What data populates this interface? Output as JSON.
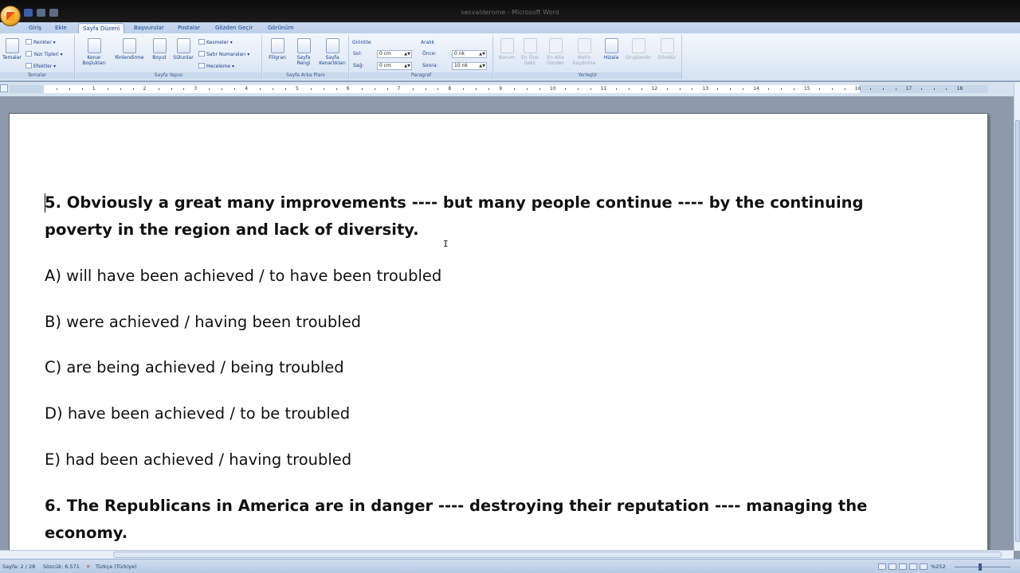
{
  "window": {
    "title": "sesvalderome - Microsoft Word"
  },
  "tabs": [
    {
      "label": "Giriş",
      "active": false
    },
    {
      "label": "Ekle",
      "active": false
    },
    {
      "label": "Sayfa Düzeni",
      "active": true
    },
    {
      "label": "Başvurular",
      "active": false
    },
    {
      "label": "Postalar",
      "active": false
    },
    {
      "label": "Gözden Geçir",
      "active": false
    },
    {
      "label": "Görünüm",
      "active": false
    }
  ],
  "ribbon": {
    "temalar": {
      "themes_button": "Temalar",
      "colors": "Renkler",
      "fonts": "Yazı Tipleri",
      "effects": "Efektler",
      "group_label": "Temalar"
    },
    "sayfa_yapisi": {
      "margins": "Kenar Boşlukları",
      "orientation": "Yönlendirme",
      "size": "Boyut",
      "columns": "Sütunlar",
      "breaks": "Kesmeler",
      "line_numbers": "Satır Numaraları",
      "hyphenation": "Heceleme",
      "group_label": "Sayfa Yapısı"
    },
    "sayfa_arka_plani": {
      "watermark": "Filigran",
      "page_color": "Sayfa Rengi",
      "page_borders": "Sayfa Kenarlıkları",
      "group_label": "Sayfa Arka Planı"
    },
    "paragraf": {
      "indent_label": "Girintile",
      "left_label": "Sol:",
      "left_value": "0 cm",
      "right_label": "Sağ:",
      "right_value": "0 cm",
      "spacing_label": "Aralık",
      "before_label": "Önce:",
      "before_value": "0 nk",
      "after_label": "Sonra:",
      "after_value": "10 nk",
      "group_label": "Paragraf"
    },
    "yerlestir": {
      "position": "Konum",
      "bring_front": "En Öne Getir",
      "send_back": "En Alta Gönder",
      "text_wrap": "Metin Kaydırma",
      "align": "Hizala",
      "group": "Gruplandır",
      "rotate": "Döndür",
      "group_label": "Yerleştir"
    }
  },
  "ruler": {
    "numbers": [
      "1",
      "2",
      "3",
      "4",
      "5",
      "6",
      "7",
      "8",
      "9",
      "10",
      "11",
      "12",
      "13",
      "14",
      "15",
      "16",
      "17",
      "18"
    ]
  },
  "document": {
    "paragraphs": [
      {
        "text": "5. Obviously a great many improvements ---- but many people continue ---- by the continuing",
        "bold": true
      },
      {
        "text": "poverty in the region and lack of diversity.",
        "bold": true
      },
      {
        "text": "A) will have been achieved / to have been troubled",
        "bold": false
      },
      {
        "text": "B) were achieved / having been troubled",
        "bold": false
      },
      {
        "text": "C) are being achieved / being troubled",
        "bold": false
      },
      {
        "text": "D) have been achieved / to be troubled",
        "bold": false
      },
      {
        "text": "E) had been achieved / having troubled",
        "bold": false
      },
      {
        "text": "6. The Republicans in America are in danger ---- destroying their reputation   ---- managing the",
        "bold": true
      },
      {
        "text": "economy.",
        "bold": true
      }
    ]
  },
  "status": {
    "page": "Sayfa: 2 / 28",
    "words": "Sözcük: 6.571",
    "language": "Türkçe (Türkiye)",
    "zoom": "%252"
  }
}
